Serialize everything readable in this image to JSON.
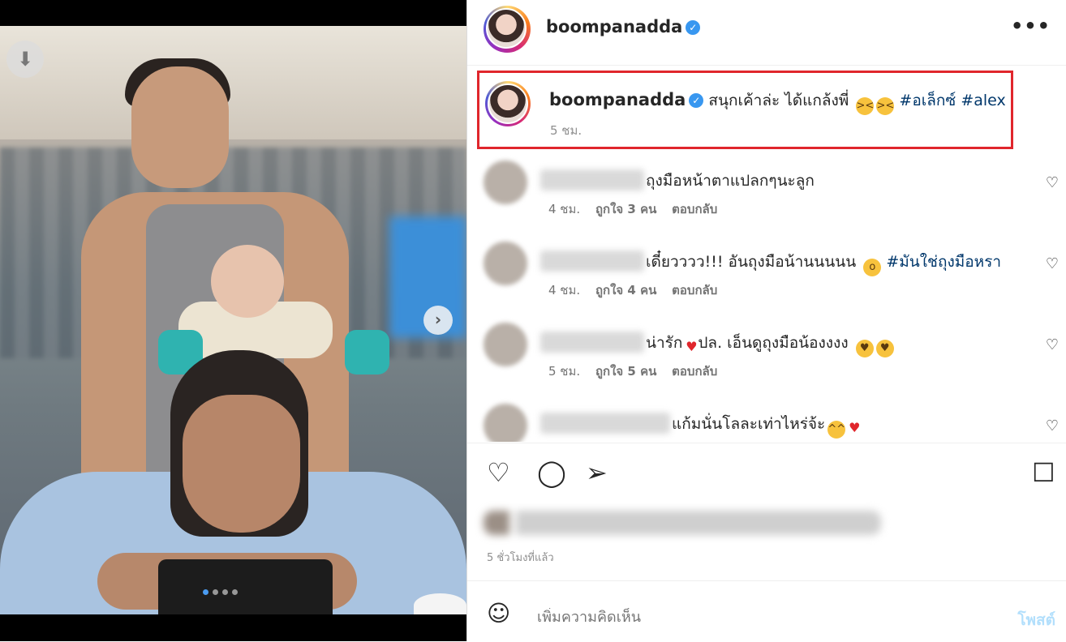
{
  "header": {
    "username": "boompanadda",
    "more": "•••"
  },
  "caption": {
    "username": "boompanadda",
    "text": "สนุกเค้าล่ะ ได้แกล้งพี่",
    "tags": [
      "#อเล็กซ์",
      "#alex"
    ],
    "time": "5 ชม."
  },
  "comments": [
    {
      "text": "ถุงมือหน้าตาแปลกๆนะลูก",
      "time": "4 ชม.",
      "likes": "ถูกใจ 3 คน",
      "reply": "ตอบกลับ"
    },
    {
      "text": "เดี๋ยวววว!!! อันถุงมือน้านนนนน",
      "tag": "#มันใช่ถุงมือหรา",
      "time": "4 ชม.",
      "likes": "ถูกใจ 4 คน",
      "reply": "ตอบกลับ"
    },
    {
      "text": "น่ารัก",
      "text2": "ปล. เอ็นดูถุงมือน้องงงง",
      "time": "5 ชม.",
      "likes": "ถูกใจ 5 คน",
      "reply": "ตอบกลับ"
    },
    {
      "text": "แก้มนั่นโลละเท่าไหร่จ้ะ"
    }
  ],
  "footer": {
    "time_ago": "5 ชั่วโมงที่แล้ว",
    "add_comment_placeholder": "เพิ่มความคิดเห็น",
    "post_label": "โพสต์"
  },
  "icons": {
    "download": "download-icon",
    "next": "chevron-right-icon",
    "like": "heart-icon",
    "comment": "comment-icon",
    "share": "send-icon",
    "save": "bookmark-icon",
    "emoji": "emoji-icon"
  },
  "carousel": {
    "slides": 4,
    "active": 0
  },
  "colors": {
    "accent": "#e0262c",
    "verified": "#3897f0",
    "hashtag": "#00376b"
  }
}
